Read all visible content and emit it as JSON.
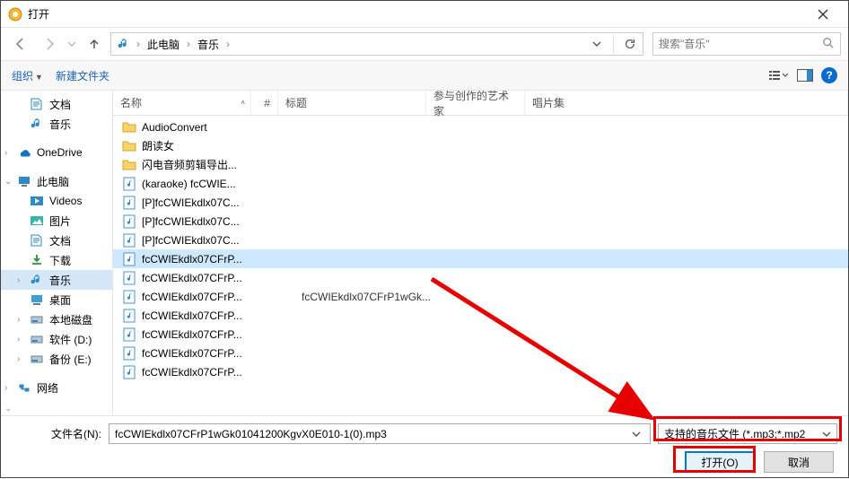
{
  "window": {
    "title": "打开"
  },
  "nav": {
    "breadcrumb": [
      "此电脑",
      "音乐"
    ],
    "search_placeholder": "搜索\"音乐\""
  },
  "toolbar": {
    "organize": "组织",
    "new_folder": "新建文件夹"
  },
  "sidebar": {
    "items": [
      {
        "label": "文档",
        "icon": "folder-doc",
        "level": 2
      },
      {
        "label": "音乐",
        "icon": "folder-music",
        "level": 2
      },
      {
        "sep": true
      },
      {
        "label": "OneDrive",
        "icon": "onedrive",
        "level": 1,
        "caret": ">"
      },
      {
        "sep": true
      },
      {
        "label": "此电脑",
        "icon": "thispc",
        "level": 1,
        "caret": "v"
      },
      {
        "label": "Videos",
        "icon": "video",
        "level": 2
      },
      {
        "label": "图片",
        "icon": "pictures",
        "level": 2
      },
      {
        "label": "文档",
        "icon": "documents",
        "level": 2
      },
      {
        "label": "下载",
        "icon": "downloads",
        "level": 2
      },
      {
        "label": "音乐",
        "icon": "music",
        "level": 2,
        "active": true,
        "caret": ">"
      },
      {
        "label": "桌面",
        "icon": "desktop",
        "level": 2
      },
      {
        "label": "本地磁盘",
        "icon": "disk",
        "level": 2,
        "caret": ">"
      },
      {
        "label": "软件 (D:)",
        "icon": "disk",
        "level": 2,
        "caret": ">"
      },
      {
        "label": "备份 (E:)",
        "icon": "disk",
        "level": 2,
        "caret": ">"
      },
      {
        "sep": true
      },
      {
        "label": "网络",
        "icon": "network",
        "level": 1,
        "caret": ">"
      }
    ]
  },
  "columns": {
    "name": "名称",
    "num": "#",
    "title": "标题",
    "artist": "参与创作的艺术家",
    "album": "唱片集"
  },
  "files": [
    {
      "icon": "folder",
      "name": "AudioConvert"
    },
    {
      "icon": "folder",
      "name": "朗读女"
    },
    {
      "icon": "folder",
      "name": "闪电音频剪辑导出..."
    },
    {
      "icon": "audio",
      "name": "(karaoke) fcCWIE..."
    },
    {
      "icon": "audio",
      "name": "[P]fcCWIEkdlx07C..."
    },
    {
      "icon": "audio",
      "name": "[P]fcCWIEkdlx07C..."
    },
    {
      "icon": "audio",
      "name": "[P]fcCWIEkdlx07C..."
    },
    {
      "icon": "audio",
      "name": "fcCWIEkdlx07CFrP...",
      "selected": true
    },
    {
      "icon": "audio",
      "name": "fcCWIEkdlx07CFrP..."
    },
    {
      "icon": "audio",
      "name": "fcCWIEkdlx07CFrP...",
      "title": "fcCWIEkdlx07CFrP1wGk..."
    },
    {
      "icon": "audio",
      "name": "fcCWIEkdlx07CFrP..."
    },
    {
      "icon": "audio",
      "name": "fcCWIEkdlx07CFrP..."
    },
    {
      "icon": "audio",
      "name": "fcCWIEkdlx07CFrP..."
    },
    {
      "icon": "audio",
      "name": "fcCWIEkdlx07CFrP..."
    }
  ],
  "bottom": {
    "filename_label": "文件名(N):",
    "filename_value": "fcCWIEkdlx07CFrP1wGk01041200KgvX0E010-1(0).mp3",
    "filter_text": "支持的音乐文件 (*.mp3;*.mp2",
    "open": "打开(O)",
    "cancel": "取消"
  }
}
